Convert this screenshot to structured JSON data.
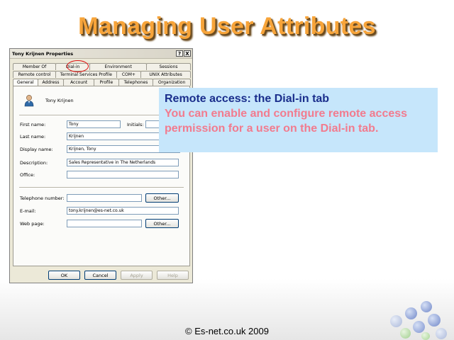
{
  "slide": {
    "title": "Managing User Attributes",
    "footer": "© Es-net.co.uk 2009"
  },
  "dialog": {
    "title": "Tony Krijnen Properties",
    "help_btn": "?",
    "close_btn": "X",
    "tabs_row1": [
      "Member Of",
      "Dial-in",
      "Environment",
      "Sessions"
    ],
    "tabs_row2": [
      "Remote control",
      "Terminal Services Profile",
      "COM+",
      "UNIX Attributes"
    ],
    "tabs_row3": [
      "General",
      "Address",
      "Account",
      "Profile",
      "Telephones",
      "Organization"
    ],
    "active_tab": "General",
    "user_name": "Tony Krijnen",
    "fields": {
      "first_name": {
        "label": "First name:",
        "value": "Tony"
      },
      "initials": {
        "label": "Initials:",
        "value": ""
      },
      "last_name": {
        "label": "Last name:",
        "value": "Krijnen"
      },
      "display_name": {
        "label": "Display name:",
        "value": "Krijnen, Tony"
      },
      "description": {
        "label": "Description:",
        "value": "Sales Representative in The Netherlands"
      },
      "office": {
        "label": "Office:",
        "value": ""
      },
      "telephone": {
        "label": "Telephone number:",
        "value": ""
      },
      "email": {
        "label": "E-mail:",
        "value": "tony.krijnen@es-net.co.uk"
      },
      "web_page": {
        "label": "Web page:",
        "value": ""
      }
    },
    "other_btn": "Other...",
    "other_btn2": "Other...",
    "ok": "OK",
    "cancel": "Cancel",
    "apply": "Apply",
    "help": "Help"
  },
  "callout": {
    "heading": "Remote access: the Dial-in tab",
    "body": "You can enable and configure remote access permission for a user on the Dial-in tab."
  },
  "colors": {
    "title_orange": "#f7a43a",
    "callout_bg": "#c6e6fb",
    "callout_heading": "#1a2e8c",
    "callout_body": "#f27b8e",
    "highlight_circle": "#dd1111"
  }
}
